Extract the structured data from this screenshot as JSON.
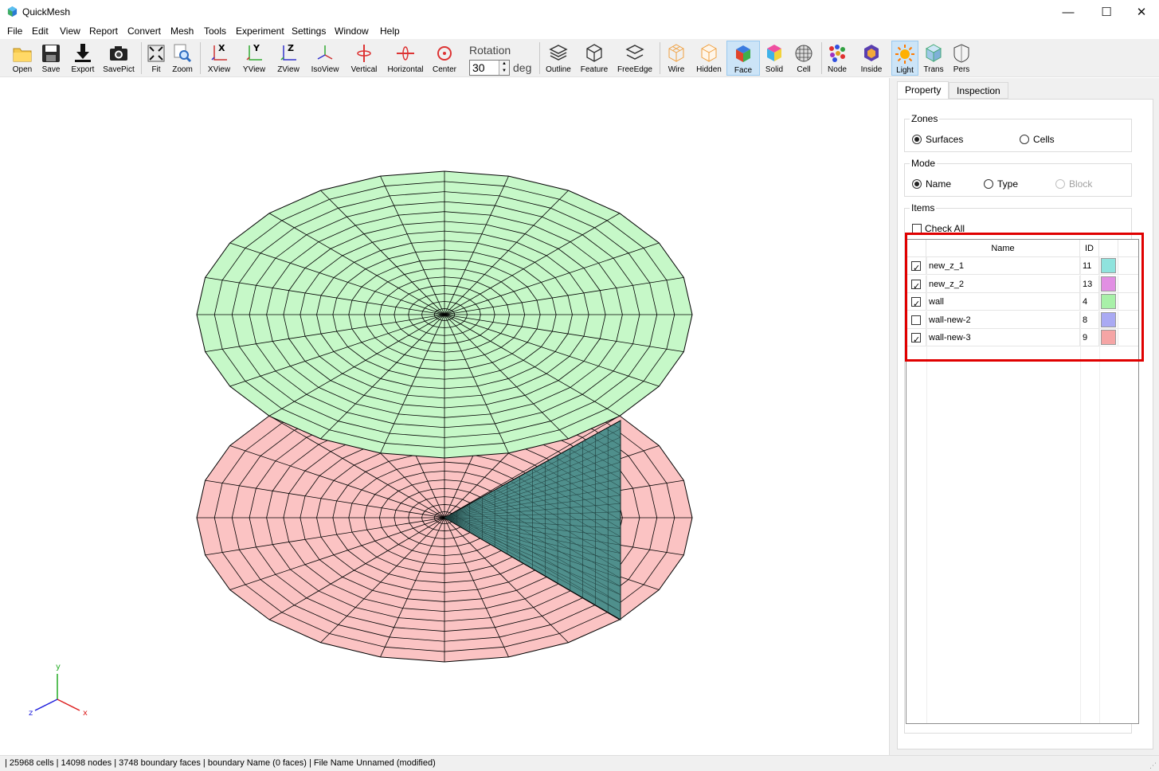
{
  "app": {
    "title": "QuickMesh"
  },
  "window_controls": {
    "minimize": "—",
    "maximize": "☐",
    "close": "✕"
  },
  "menu": [
    "File",
    "Edit",
    "View",
    "Report",
    "Convert",
    "Mesh",
    "Tools",
    "Experiment",
    "Settings",
    "Window",
    "Help"
  ],
  "toolbar": {
    "buttons": [
      {
        "id": "open",
        "label": "Open",
        "icon": "folder-icon"
      },
      {
        "id": "save",
        "label": "Save",
        "icon": "floppy-icon"
      },
      {
        "id": "export",
        "label": "Export",
        "icon": "download-icon"
      },
      {
        "id": "savepict",
        "label": "SavePict",
        "icon": "camera-icon"
      },
      {
        "id": "fit",
        "label": "Fit",
        "icon": "fit-icon"
      },
      {
        "id": "zoom",
        "label": "Zoom",
        "icon": "zoom-icon"
      },
      {
        "id": "xview",
        "label": "XView",
        "icon": "x-axis-view-icon"
      },
      {
        "id": "yview",
        "label": "YView",
        "icon": "y-axis-view-icon"
      },
      {
        "id": "zview",
        "label": "ZView",
        "icon": "z-axis-view-icon"
      },
      {
        "id": "isoview",
        "label": "IsoView",
        "icon": "iso-view-icon"
      },
      {
        "id": "vertical",
        "label": "Vertical",
        "icon": "vertical-rotate-icon"
      },
      {
        "id": "horizontal",
        "label": "Horizontal",
        "icon": "horizontal-rotate-icon"
      },
      {
        "id": "center",
        "label": "Center",
        "icon": "target-icon"
      },
      {
        "id": "outline",
        "label": "Outline",
        "icon": "outline-icon"
      },
      {
        "id": "feature",
        "label": "Feature",
        "icon": "feature-icon"
      },
      {
        "id": "freeedge",
        "label": "FreeEdge",
        "icon": "free-edge-icon"
      },
      {
        "id": "wire",
        "label": "Wire",
        "icon": "wire-cube-icon"
      },
      {
        "id": "hidden",
        "label": "Hidden",
        "icon": "hidden-cube-icon"
      },
      {
        "id": "face",
        "label": "Face",
        "icon": "face-cube-icon",
        "active": true
      },
      {
        "id": "solid",
        "label": "Solid",
        "icon": "solid-cube-icon"
      },
      {
        "id": "cell",
        "label": "Cell",
        "icon": "cell-sphere-icon"
      },
      {
        "id": "node",
        "label": "Node",
        "icon": "node-icon"
      },
      {
        "id": "inside",
        "label": "Inside",
        "icon": "inside-icon"
      },
      {
        "id": "light",
        "label": "Light",
        "icon": "sun-icon",
        "active": true
      },
      {
        "id": "trans",
        "label": "Trans",
        "icon": "transparent-cube-icon"
      },
      {
        "id": "pers",
        "label": "Pers",
        "icon": "perspective-icon"
      }
    ],
    "rotation": {
      "label": "Rotation",
      "value": "30",
      "unit": "deg"
    }
  },
  "panel": {
    "tabs": [
      {
        "label": "Property",
        "active": true
      },
      {
        "label": "Inspection",
        "active": false
      }
    ],
    "zones": {
      "title": "Zones",
      "options": [
        {
          "label": "Surfaces",
          "selected": true
        },
        {
          "label": "Cells",
          "selected": false
        }
      ]
    },
    "mode": {
      "title": "Mode",
      "options": [
        {
          "label": "Name",
          "selected": true,
          "disabled": false
        },
        {
          "label": "Type",
          "selected": false,
          "disabled": false
        },
        {
          "label": "Block",
          "selected": false,
          "disabled": true
        }
      ]
    },
    "items": {
      "title": "Items",
      "check_all_label": "Check All",
      "check_all": false,
      "columns": {
        "name": "Name",
        "id": "ID"
      },
      "rows": [
        {
          "checked": true,
          "name": "new_z_1",
          "id": "11",
          "color": "#8fe3dd"
        },
        {
          "checked": true,
          "name": "new_z_2",
          "id": "13",
          "color": "#e18fe3"
        },
        {
          "checked": true,
          "name": "wall",
          "id": "4",
          "color": "#a8f0a8"
        },
        {
          "checked": false,
          "name": "wall-new-2",
          "id": "8",
          "color": "#aaaaf3"
        },
        {
          "checked": true,
          "name": "wall-new-3",
          "id": "9",
          "color": "#f5a5a5"
        }
      ]
    }
  },
  "viewport": {
    "colors": {
      "top_disk": "#c6f8c8",
      "bottom_disk": "#fbc3c3",
      "wall_mesh": "#4f8f8c",
      "edge": "#000000"
    },
    "axes": {
      "x": "x",
      "y": "y",
      "z": "z"
    }
  },
  "status": "| 25968 cells | 14098 nodes | 3748 boundary faces |  boundary Name  (0 faces) | File Name Unnamed (modified)"
}
